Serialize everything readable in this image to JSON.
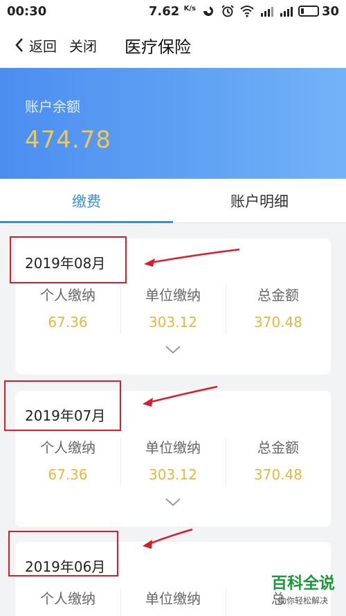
{
  "status_bar": {
    "time": "00:30",
    "speed": "7.62",
    "speed_unit": "K/s",
    "battery": "30",
    "battery_level": 0.3
  },
  "nav": {
    "back_label": "返回",
    "close_label": "关闭",
    "title": "医疗保险"
  },
  "balance": {
    "label": "账户余额",
    "value": "474.78"
  },
  "tabs": [
    {
      "label": "缴费",
      "active": true
    },
    {
      "label": "账户明细",
      "active": false
    }
  ],
  "records": [
    {
      "month": "2019年08月",
      "columns": [
        {
          "label": "个人缴纳",
          "value": "67.36"
        },
        {
          "label": "单位缴纳",
          "value": "303.12"
        },
        {
          "label": "总金额",
          "value": "370.48"
        }
      ]
    },
    {
      "month": "2019年07月",
      "columns": [
        {
          "label": "个人缴纳",
          "value": "67.36"
        },
        {
          "label": "单位缴纳",
          "value": "303.12"
        },
        {
          "label": "总金额",
          "value": "370.48"
        }
      ]
    },
    {
      "month": "2019年06月",
      "columns": [
        {
          "label": "个人缴纳",
          "value": ""
        },
        {
          "label": "单位缴纳",
          "value": ""
        },
        {
          "label": "总",
          "value": ""
        }
      ]
    }
  ],
  "watermark": {
    "brand": "百科全说",
    "tagline": "助你轻松解决"
  },
  "colors": {
    "accent": "#3b8fd9",
    "amount": "#e8b63a",
    "balance_value": "#f2c94c",
    "annotation": "#e0182a",
    "watermark": "#1a9b38"
  }
}
